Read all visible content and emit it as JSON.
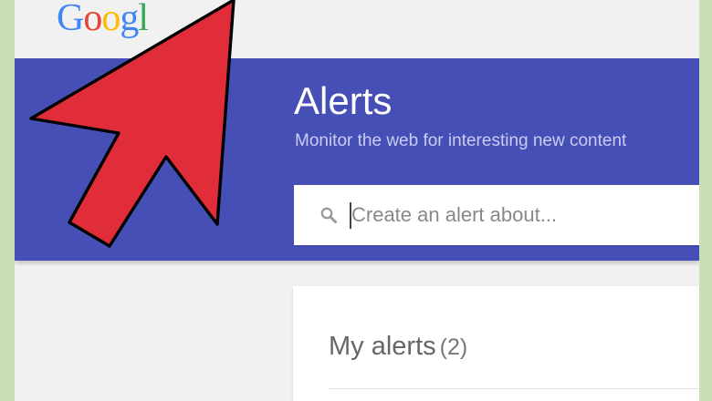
{
  "logo": {
    "letters": [
      {
        "char": "G",
        "color": "#4285F4"
      },
      {
        "char": "o",
        "color": "#EA4335"
      },
      {
        "char": "o",
        "color": "#FBBC05"
      },
      {
        "char": "g",
        "color": "#4285F4"
      },
      {
        "char": "l",
        "color": "#34A853"
      }
    ]
  },
  "hero": {
    "title": "Alerts",
    "subtitle": "Monitor the web for interesting new content"
  },
  "search": {
    "icon": "search-icon",
    "placeholder": "Create an alert about..."
  },
  "my_alerts": {
    "heading": "My alerts",
    "count": "(2)"
  },
  "overlay": {
    "icon": "red-arrow-pointer-icon",
    "fill_color": "#e12d3a",
    "outline_color": "#000000"
  },
  "colors": {
    "hero_background": "#464fb6",
    "page_background": "#f1f1f1",
    "outer_background": "#c9dfb7"
  }
}
